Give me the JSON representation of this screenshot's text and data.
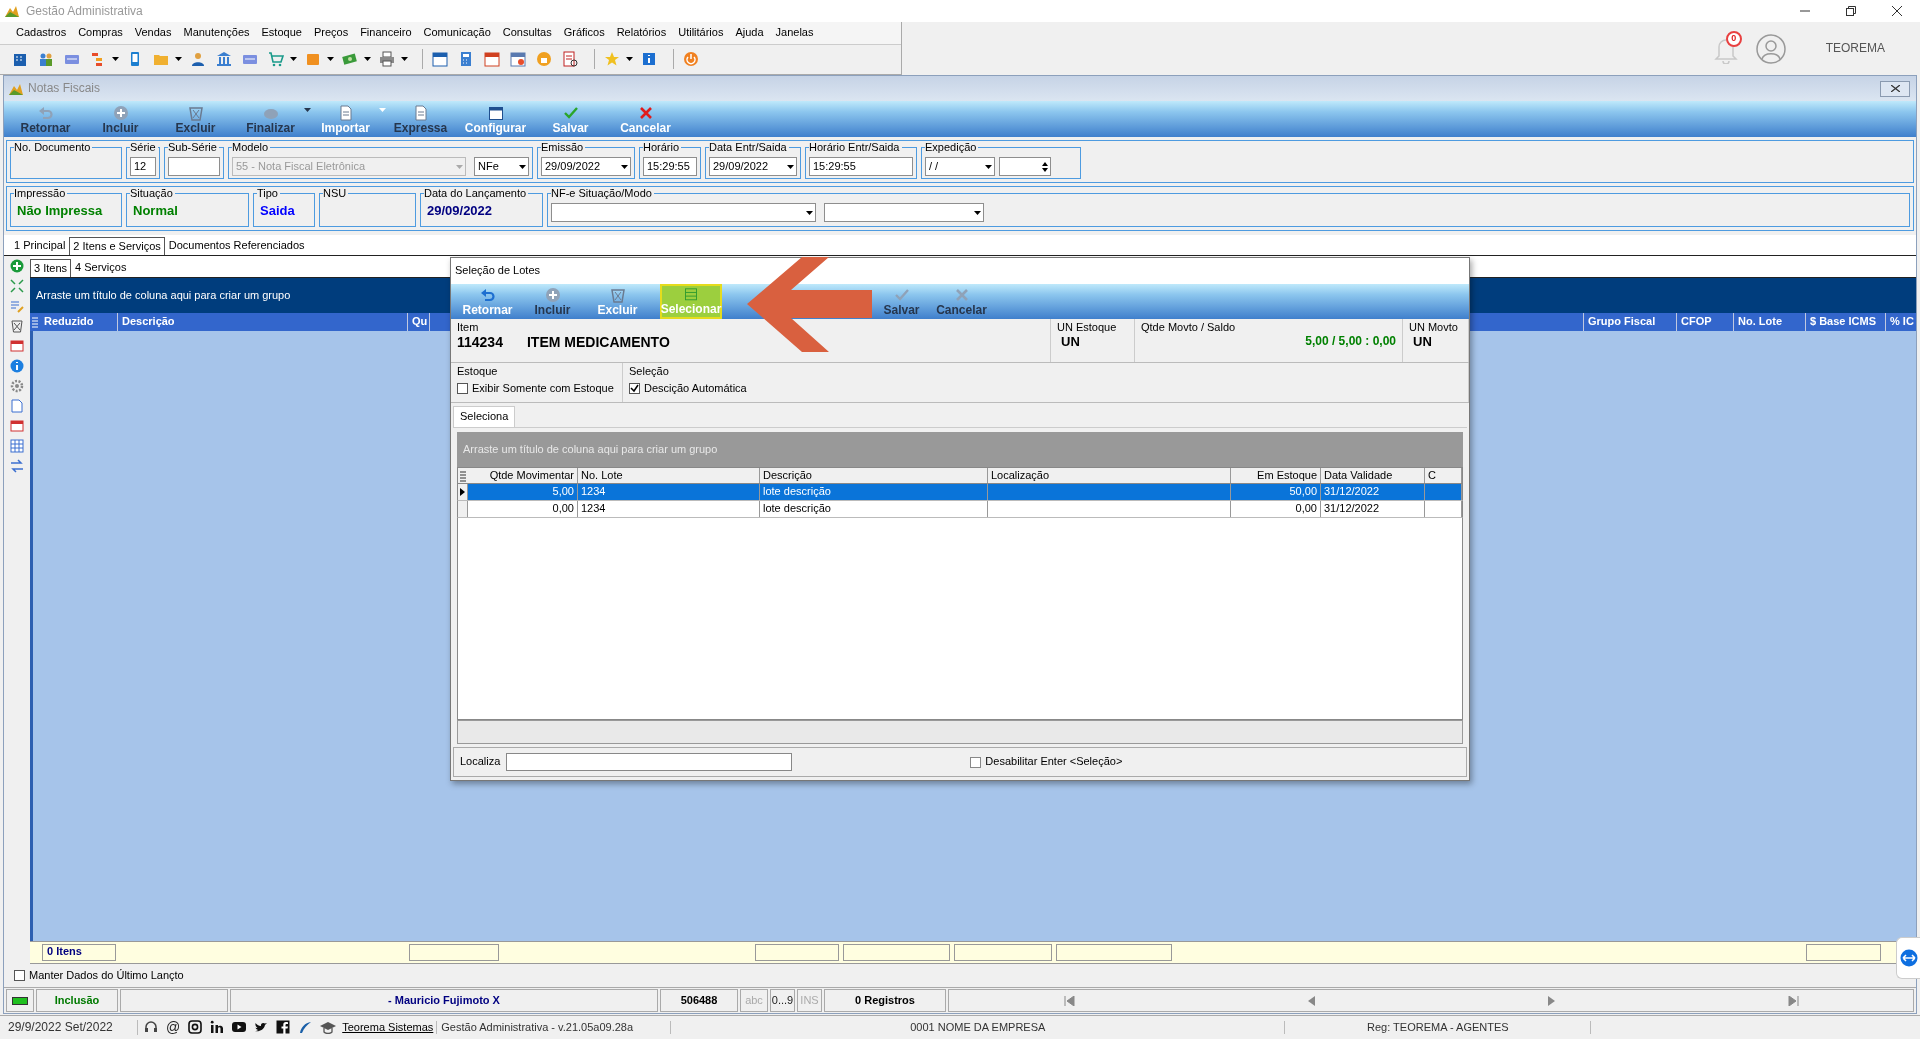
{
  "app": {
    "title": "Gestão Administrativa",
    "menu": [
      "Cadastros",
      "Compras",
      "Vendas",
      "Manutenções",
      "Estoque",
      "Preços",
      "Financeiro",
      "Comunicação",
      "Consultas",
      "Gráficos",
      "Relatórios",
      "Utilitários",
      "Ajuda",
      "Janelas"
    ],
    "notifications": "0",
    "user": "TEOREMA"
  },
  "form": {
    "title": "Notas Fiscais",
    "toolbar": [
      {
        "label": "Retornar",
        "kind": "back",
        "disabled": true,
        "dropdown": false
      },
      {
        "label": "Incluir",
        "kind": "add",
        "disabled": true,
        "dropdown": false
      },
      {
        "label": "Excluir",
        "kind": "trash",
        "disabled": true,
        "dropdown": false
      },
      {
        "label": "Finalizar",
        "kind": "cloud",
        "disabled": true,
        "dropdown": true
      },
      {
        "label": "Importar",
        "kind": "document",
        "disabled": false,
        "dropdown": true
      },
      {
        "label": "Expressa",
        "kind": "document",
        "disabled": true,
        "dropdown": false
      },
      {
        "label": "Configurar",
        "kind": "window",
        "disabled": false,
        "dropdown": false
      },
      {
        "label": "Salvar",
        "kind": "check",
        "disabled": false,
        "dropdown": false
      },
      {
        "label": "Cancelar",
        "kind": "cancel",
        "disabled": false,
        "dropdown": false
      }
    ],
    "header_fields": [
      {
        "label": "No. Documento",
        "kind": "empty"
      },
      {
        "label": "Série",
        "kind": "input",
        "value": "12"
      },
      {
        "label": "Sub-Série",
        "kind": "input"
      },
      {
        "label": "Modelo",
        "kind": "model",
        "value": "55 - Nota Fiscal Eletrônica",
        "type_value": "NFe"
      },
      {
        "label": "Emissão",
        "kind": "select",
        "value": "29/09/2022"
      },
      {
        "label": "Horário",
        "kind": "input",
        "value": "15:29:55"
      },
      {
        "label": "Data Entr/Saida",
        "kind": "select",
        "value": "29/09/2022"
      },
      {
        "label": "Horário Entr/Saida",
        "kind": "input",
        "value": "15:29:55"
      },
      {
        "label": "Expedição",
        "kind": "expedition",
        "value": "/ /"
      }
    ],
    "status_fields": [
      {
        "label": "Impressão",
        "kind": "value",
        "value": "Não Impressa",
        "color": "#008000"
      },
      {
        "label": "Situação",
        "kind": "value",
        "value": "Normal",
        "color": "#008000"
      },
      {
        "label": "Tipo",
        "kind": "value",
        "value": "Saida",
        "color": "#0000ff"
      },
      {
        "label": "NSU",
        "kind": "value"
      },
      {
        "label": "Data do Lançamento",
        "kind": "value",
        "value": "29/09/2022",
        "color": "#000080"
      },
      {
        "label": "NF-e Situação/Modo",
        "kind": "selects"
      }
    ],
    "tabs": [
      {
        "label": "1 Principal",
        "selected": false
      },
      {
        "label": "2 Itens e Serviços",
        "selected": true
      },
      {
        "label": "Documentos Referenciados",
        "selected": false
      }
    ],
    "subtabs": [
      {
        "label": "3 Itens",
        "selected": true
      },
      {
        "label": "4 Serviços",
        "selected": false
      }
    ],
    "grid": {
      "group_hint": "Arraste um título de coluna aqui para criar um grupo",
      "columns_left": [
        "Reduzido",
        "Descrição",
        "Qu"
      ],
      "columns_right": [
        "Grupo Fiscal",
        "CFOP",
        "No. Lote",
        "$ Base ICMS",
        "% IC"
      ],
      "footer_count": "0 Itens"
    },
    "keep_last": {
      "label": "Manter Dados do Último Lançto",
      "checked": false
    },
    "status_bar": {
      "mode": "Inclusão",
      "user": "- Mauricio Fujimoto X",
      "number": "506488",
      "indicators": [
        {
          "label": "abc",
          "on": false
        },
        {
          "label": "0...9",
          "on": true
        },
        {
          "label": "INS",
          "on": false
        }
      ],
      "records": "0 Registros"
    }
  },
  "taskbar": {
    "date": "29/9/2022 Set/2022",
    "email_symbol": "@",
    "link": "Teorema Sistemas",
    "version": "Gestão Administrativa - v.21.05a09.28a",
    "company": "0001 NOME DA EMPRESA",
    "registration": "Reg: TEOREMA - AGENTES"
  },
  "dialog": {
    "title": "Seleção de Lotes",
    "toolbar": [
      {
        "label": "Retornar",
        "kind": "back",
        "disabled": false,
        "highlighted": false
      },
      {
        "label": "Incluir",
        "kind": "add",
        "disabled": true,
        "highlighted": false
      },
      {
        "label": "Excluir",
        "kind": "trash",
        "disabled": false,
        "highlighted": false
      },
      {
        "label": "Selecionar",
        "kind": "select",
        "disabled": false,
        "highlighted": true
      },
      {
        "label": "Salvar",
        "kind": "check",
        "disabled": true,
        "highlighted": false
      },
      {
        "label": "Cancelar",
        "kind": "cancel",
        "disabled": true,
        "highlighted": false
      }
    ],
    "item": {
      "label": "Item",
      "code": "114234",
      "name": "ITEM MEDICAMENTO"
    },
    "stock_unit": {
      "label": "UN Estoque",
      "value": "UN"
    },
    "quantity": {
      "label": "Qtde Movto / Saldo",
      "value": "5,00 / 5,00 : 0,00"
    },
    "move_unit": {
      "label": "UN Movto",
      "value": "UN"
    },
    "stock_group": {
      "label": "Estoque",
      "option": {
        "label": "Exibir Somente com Estoque",
        "checked": false
      }
    },
    "selection_group": {
      "label": "Seleção",
      "option": {
        "label": "Descição Automática",
        "checked": true
      }
    },
    "tab": "Seleciona",
    "grid": {
      "group_hint": "Arraste um título de coluna aqui para criar um grupo",
      "columns": [
        "Qtde Movimentar",
        "No. Lote",
        "Descrição",
        "Localização",
        "Em Estoque",
        "Data Validade",
        "C"
      ],
      "rows": [
        {
          "qty": "5,00",
          "lot": "1234",
          "description": "lote descrição",
          "stock": "50,00",
          "validity": "31/12/2022",
          "selected": true
        },
        {
          "qty": "0,00",
          "lot": "1234",
          "description": "lote descrição",
          "stock": "0,00",
          "validity": "31/12/2022",
          "selected": false
        }
      ]
    },
    "search": {
      "label": "Localiza"
    },
    "disable_enter": {
      "label": "Desabilitar Enter <Seleção>",
      "checked": false
    }
  }
}
